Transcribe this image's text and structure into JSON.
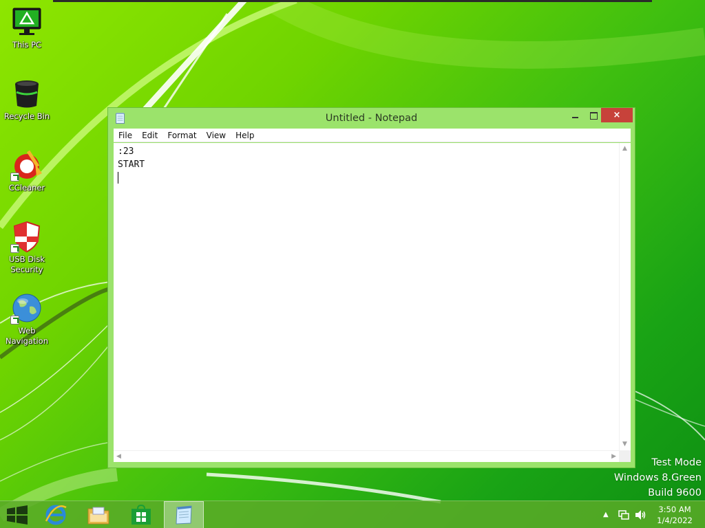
{
  "desktop": {
    "icons": [
      {
        "label": "This PC",
        "icon": "monitor-icon"
      },
      {
        "label": "Recycle Bin",
        "icon": "recycle-bin-icon"
      },
      {
        "label": "CCleaner",
        "icon": "ccleaner-icon"
      },
      {
        "label": "USB Disk Security",
        "icon": "shield-icon"
      },
      {
        "label": "Web Navigation",
        "icon": "globe-icon"
      }
    ]
  },
  "notepad": {
    "title": "Untitled - Notepad",
    "close_label": "×",
    "menu": [
      "File",
      "Edit",
      "Format",
      "View",
      "Help"
    ],
    "content": ":23\nSTART\n"
  },
  "watermark": {
    "line1": "Test Mode",
    "line2": "Windows 8.Green",
    "line3": "Build 9600"
  },
  "taskbar": {
    "items": [
      "start-icon",
      "internet-explorer-icon",
      "file-explorer-icon",
      "store-icon",
      "notepad-icon"
    ],
    "active": "notepad-icon",
    "tray": {
      "time": "3:50 AM",
      "date": "1/4/2022"
    }
  },
  "colors": {
    "accent_green": "#6fd400",
    "window_frame": "#9be36b",
    "close_button": "#c7423a"
  }
}
